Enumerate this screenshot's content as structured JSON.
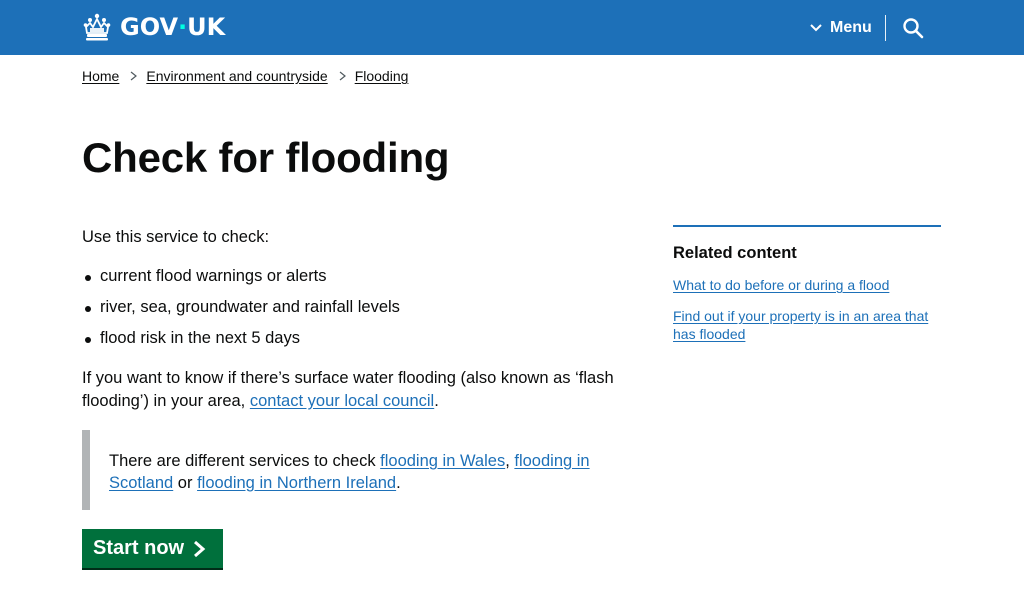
{
  "header": {
    "logo_text_left": "GOV",
    "logo_dot": "·",
    "logo_text_right": "UK",
    "menu_label": "Menu",
    "icons": [
      "crown-icon",
      "chevron-down-icon",
      "search-icon"
    ]
  },
  "breadcrumb": {
    "items": [
      "Home",
      "Environment and countryside",
      "Flooding"
    ]
  },
  "page": {
    "title": "Check for flooding",
    "intro": "Use this service to check:",
    "bullets": [
      "current flood warnings or alerts",
      "river, sea, groundwater and rainfall levels",
      "flood risk in the next 5 days"
    ],
    "surface_text_before": "If you want to know if there’s surface water flooding (also known as ‘flash flooding’) in your area, ",
    "surface_link": "contact your local council",
    "surface_text_after": "."
  },
  "inset": {
    "text_before": "There are different services to check ",
    "link_wales": "flooding in Wales",
    "comma": ", ",
    "link_scotland": "flooding in Scotland",
    "or": " or ",
    "link_ni": "flooding in Northern Ireland",
    "end": "."
  },
  "start_button": {
    "label": "Start now"
  },
  "related": {
    "heading": "Related content",
    "links": [
      "What to do before or during a flood",
      "Find out if your property is in an area that has flooded"
    ]
  },
  "colors": {
    "header_blue": "#1d70b8",
    "link_blue": "#1d70b8",
    "start_green": "#00703c",
    "inset_grey": "#b1b4b6",
    "text": "#0b0c0c"
  }
}
